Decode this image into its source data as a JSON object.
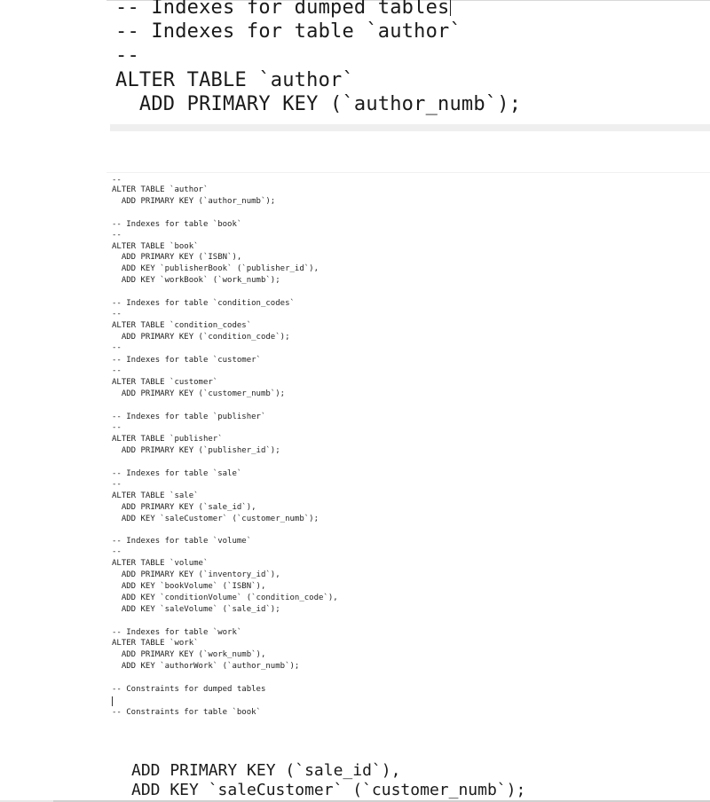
{
  "top_editor": {
    "lines": [
      "-- Indexes for dumped tables",
      "-- Indexes for table `author`",
      "--",
      "ALTER TABLE `author`",
      "  ADD PRIMARY KEY (`author_numb`);"
    ]
  },
  "sql_listing": {
    "lines": [
      "--",
      "ALTER TABLE `author`",
      "  ADD PRIMARY KEY (`author_numb`);",
      "",
      "-- Indexes for table `book`",
      "--",
      "ALTER TABLE `book`",
      "  ADD PRIMARY KEY (`ISBN`),",
      "  ADD KEY `publisherBook` (`publisher_id`),",
      "  ADD KEY `workBook` (`work_numb`);",
      "",
      "-- Indexes for table `condition_codes`",
      "--",
      "ALTER TABLE `condition_codes`",
      "  ADD PRIMARY KEY (`condition_code`);",
      "--",
      "-- Indexes for table `customer`",
      "--",
      "ALTER TABLE `customer`",
      "  ADD PRIMARY KEY (`customer_numb`);",
      "",
      "-- Indexes for table `publisher`",
      "--",
      "ALTER TABLE `publisher`",
      "  ADD PRIMARY KEY (`publisher_id`);",
      "",
      "-- Indexes for table `sale`",
      "--",
      "ALTER TABLE `sale`",
      "  ADD PRIMARY KEY (`sale_id`),",
      "  ADD KEY `saleCustomer` (`customer_numb`);",
      "",
      "-- Indexes for table `volume`",
      "--",
      "ALTER TABLE `volume`",
      "  ADD PRIMARY KEY (`inventory_id`),",
      "  ADD KEY `bookVolume` (`ISBN`),",
      "  ADD KEY `conditionVolume` (`condition_code`),",
      "  ADD KEY `saleVolume` (`sale_id`);",
      "",
      "-- Indexes for table `work`",
      "ALTER TABLE `work`",
      "  ADD PRIMARY KEY (`work_numb`),",
      "  ADD KEY `authorWork` (`author_numb`);",
      "",
      "-- Constraints for dumped tables",
      "",
      "-- Constraints for table `book`"
    ]
  },
  "bottom_editor": {
    "lines": [
      "ADD PRIMARY KEY (`sale_id`),",
      "ADD KEY `saleCustomer` (`customer_numb`);"
    ]
  }
}
